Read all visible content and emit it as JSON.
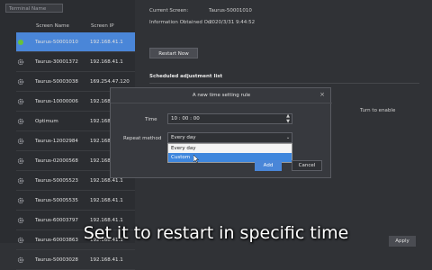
{
  "left_panel": {
    "search_placeholder": "Terminal Name",
    "col_name": "Screen Name",
    "col_ip": "Screen IP",
    "rows": [
      {
        "name": "Taurus-50001010",
        "ip": "192.168.41.1",
        "selected": true
      },
      {
        "name": "Taurus-30001372",
        "ip": "192.168.41.1",
        "selected": false
      },
      {
        "name": "Taurus-50003038",
        "ip": "169.254.47.120",
        "selected": false
      },
      {
        "name": "Taurus-10000006",
        "ip": "192.168.41.1",
        "selected": false
      },
      {
        "name": "Optimum",
        "ip": "192.168.41.1",
        "selected": false
      },
      {
        "name": "Taurus-12002984",
        "ip": "192.168.41.1",
        "selected": false
      },
      {
        "name": "Taurus-02000568",
        "ip": "192.168.41.1",
        "selected": false
      },
      {
        "name": "Taurus-50005523",
        "ip": "192.168.41.1",
        "selected": false
      },
      {
        "name": "Taurus-50005535",
        "ip": "192.168.41.1",
        "selected": false
      },
      {
        "name": "Taurus-60003797",
        "ip": "192.168.41.1",
        "selected": false
      },
      {
        "name": "Taurus-60003863",
        "ip": "192.168.41.1",
        "selected": false
      },
      {
        "name": "Taurus-50003028",
        "ip": "192.168.41.1",
        "selected": false
      }
    ]
  },
  "info": {
    "current_screen_label": "Current Screen:",
    "current_screen_value": "Taurus-50001010",
    "obtained_label": "Information Obtained On:",
    "obtained_value": "2020/3/31 9:44:52",
    "restart_button": "Restart Now",
    "scheduled_title": "Scheduled adjustment list",
    "turn_on_label": "Turn to enable",
    "apply_button": "Apply"
  },
  "dialog": {
    "title": "A new time setting rule",
    "close_glyph": "×",
    "time_label": "Time",
    "time_value": "10 : 00 : 00",
    "repeat_label": "Repeat method",
    "repeat_value": "Every day",
    "options": [
      "Every day",
      "Custom"
    ],
    "add_button": "Add",
    "cancel_button": "Cancel"
  },
  "caption": "Set it to restart in specific time",
  "colors": {
    "accent": "#4a86d8",
    "online": "#67c23a"
  }
}
